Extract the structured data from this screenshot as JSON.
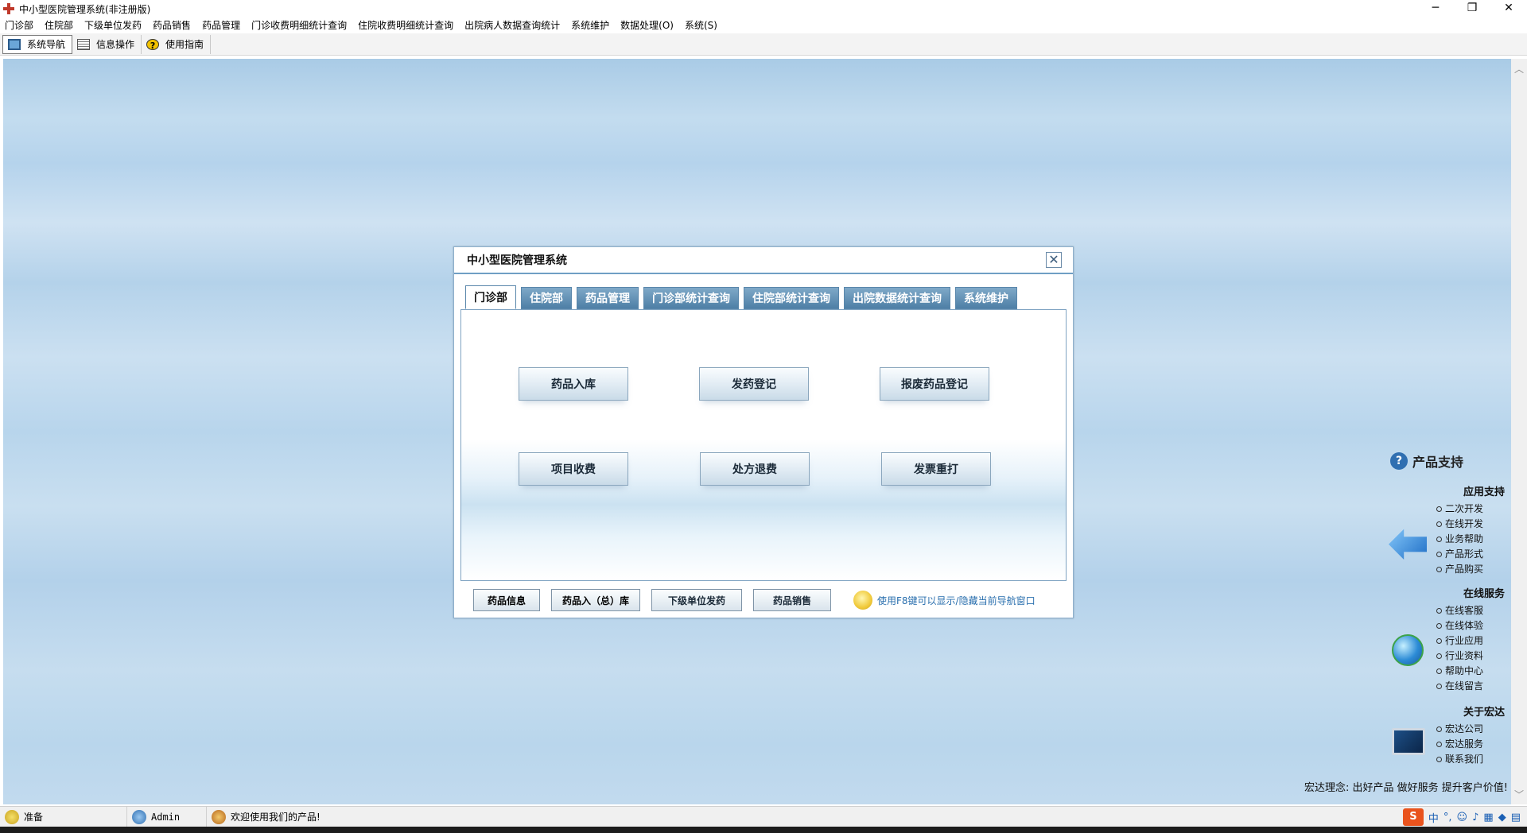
{
  "window": {
    "title": "中小型医院管理系统(非注册版)",
    "controls": [
      "─",
      "❐",
      "✕"
    ]
  },
  "menu": [
    "门诊部",
    "住院部",
    "下级单位发药",
    "药品销售",
    "药品管理",
    "门诊收费明细统计查询",
    "住院收费明细统计查询",
    "出院病人数据查询统计",
    "系统维护",
    "数据处理(O)",
    "系统(S)"
  ],
  "toolbar": {
    "nav": "系统导航",
    "info": "信息操作",
    "help": "使用指南"
  },
  "dialog": {
    "title": "中小型医院管理系统",
    "close_glyph": "✕",
    "tabs": [
      "门诊部",
      "住院部",
      "药品管理",
      "门诊部统计查询",
      "住院部统计查询",
      "出院数据统计查询",
      "系统维护"
    ],
    "active_tab": "门诊部",
    "actions": [
      "药品入库",
      "发药登记",
      "报废药品登记",
      "项目收费",
      "处方退费",
      "发票重打"
    ],
    "bottom_buttons": [
      "药品信息",
      "药品入（总）库",
      "下级单位发药",
      "药品销售"
    ],
    "hint": "使用F8键可以显示/隐藏当前导航窗口"
  },
  "support": {
    "title": "产品支持",
    "sections": [
      {
        "title": "应用支持",
        "icon": "arrow-icon",
        "items": [
          "二次开发",
          "在线开发",
          "业务帮助",
          "产品形式",
          "产品购买"
        ]
      },
      {
        "title": "在线服务",
        "icon": "globe-icon",
        "items": [
          "在线客服",
          "在线体验",
          "行业应用",
          "行业资料",
          "帮助中心",
          "在线留言"
        ]
      },
      {
        "title": "关于宏达",
        "icon": "monitor-icon",
        "items": [
          "宏达公司",
          "宏达服务",
          "联系我们"
        ]
      }
    ],
    "motto": "宏达理念: 出好产品  做好服务  提升客户价值!"
  },
  "status": {
    "ready": "准备",
    "user": "Admin",
    "welcome": "欢迎使用我们的产品!",
    "ime": {
      "logo": "S",
      "lang": "中"
    }
  },
  "scroll": {
    "up": "︿",
    "down": "﹀"
  }
}
